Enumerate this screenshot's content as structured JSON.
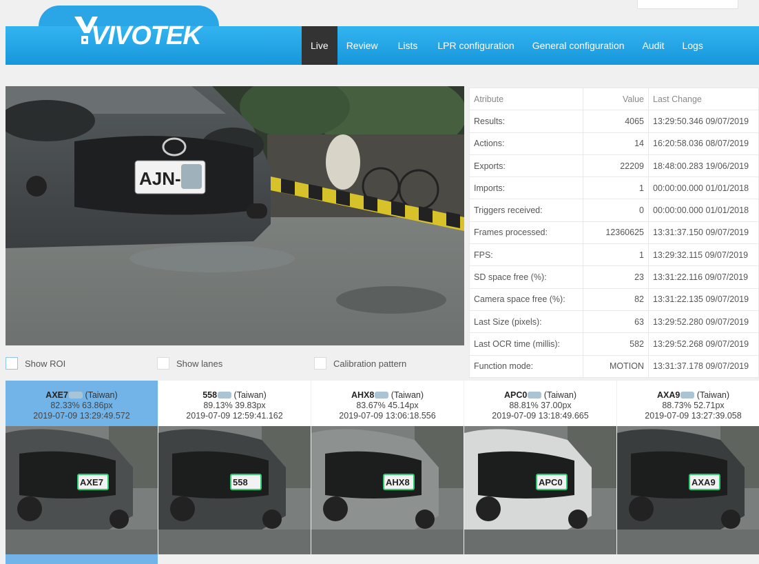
{
  "brand": "VIVOTEK",
  "nav": [
    {
      "label": "Live",
      "active": true
    },
    {
      "label": "Review"
    },
    {
      "label": "Lists"
    },
    {
      "label": "LPR configuration"
    },
    {
      "label": "General configuration"
    },
    {
      "label": "Audit"
    },
    {
      "label": "Logs"
    }
  ],
  "live_plate_text": "AJN-5",
  "options": {
    "show_roi": "Show ROI",
    "show_lanes": "Show lanes",
    "calibration": "Calibration pattern"
  },
  "table": {
    "headers": {
      "attribute": "Atribute",
      "value": "Value",
      "last_change": "Last Change"
    },
    "rows": [
      {
        "attribute": "Results:",
        "value": "4065",
        "last_change": "13:29:50.346 09/07/2019"
      },
      {
        "attribute": "Actions:",
        "value": "14",
        "last_change": "16:20:58.036 08/07/2019"
      },
      {
        "attribute": "Exports:",
        "value": "22209",
        "last_change": "18:48:00.283 19/06/2019"
      },
      {
        "attribute": "Imports:",
        "value": "1",
        "last_change": "00:00:00.000 01/01/2018"
      },
      {
        "attribute": "Triggers received:",
        "value": "0",
        "last_change": "00:00:00.000 01/01/2018"
      },
      {
        "attribute": "Frames processed:",
        "value": "12360625",
        "last_change": "13:31:37.150 09/07/2019"
      },
      {
        "attribute": "FPS:",
        "value": "1",
        "last_change": "13:29:32.115 09/07/2019"
      },
      {
        "attribute": "SD space free (%):",
        "value": "23",
        "last_change": "13:31:22.116 09/07/2019"
      },
      {
        "attribute": "Camera space free (%):",
        "value": "82",
        "last_change": "13:31:22.135 09/07/2019"
      },
      {
        "attribute": "Last Size (pixels):",
        "value": "63",
        "last_change": "13:29:52.280 09/07/2019"
      },
      {
        "attribute": "Last OCR time (millis):",
        "value": "582",
        "last_change": "13:29:52.268 09/07/2019"
      },
      {
        "attribute": "Function mode:",
        "value": "MOTION",
        "last_change": "13:31:37.178 09/07/2019"
      }
    ]
  },
  "detections": [
    {
      "plate": "AXE7",
      "country": "(Taiwan)",
      "metrics": "82.33% 63.86px",
      "timestamp": "2019-07-09 13:29:49.572",
      "selected": true,
      "plate_overlay": "AXE7"
    },
    {
      "plate": "558",
      "country": "(Taiwan)",
      "metrics": "89.13% 39.83px",
      "timestamp": "2019-07-09 12:59:41.162",
      "selected": false,
      "plate_overlay": "558"
    },
    {
      "plate": "AHX8",
      "country": "(Taiwan)",
      "metrics": "83.67% 45.14px",
      "timestamp": "2019-07-09 13:06:18.556",
      "selected": false,
      "plate_overlay": "AHX8"
    },
    {
      "plate": "APC0",
      "country": "(Taiwan)",
      "metrics": "88.81% 37.00px",
      "timestamp": "2019-07-09 13:18:49.665",
      "selected": false,
      "plate_overlay": "APC0"
    },
    {
      "plate": "AXA9",
      "country": "(Taiwan)",
      "metrics": "88.73% 52.71px",
      "timestamp": "2019-07-09 13:27:39.058",
      "selected": false,
      "plate_overlay": "AXA9"
    }
  ]
}
